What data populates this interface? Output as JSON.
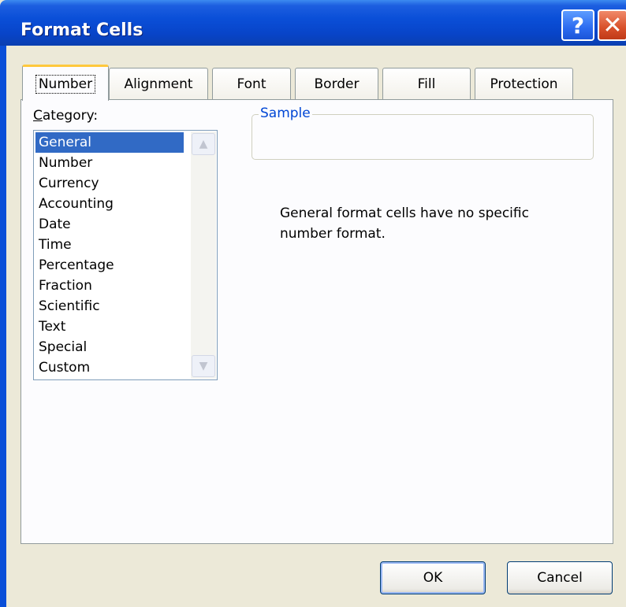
{
  "window": {
    "title": "Format Cells",
    "help_icon": "?",
    "close_icon": "✕"
  },
  "tabs": [
    {
      "label": "Number",
      "active": true
    },
    {
      "label": "Alignment"
    },
    {
      "label": "Font"
    },
    {
      "label": "Border"
    },
    {
      "label": "Fill"
    },
    {
      "label": "Protection"
    }
  ],
  "category": {
    "label": "Category:",
    "items": [
      "General",
      "Number",
      "Currency",
      "Accounting",
      "Date",
      "Time",
      "Percentage",
      "Fraction",
      "Scientific",
      "Text",
      "Special",
      "Custom"
    ],
    "selected": "General"
  },
  "sample": {
    "legend": "Sample",
    "value": ""
  },
  "description": "General format cells have no specific number format.",
  "buttons": {
    "ok": "OK",
    "cancel": "Cancel"
  },
  "colors": {
    "titlebar": "#0a4fd8",
    "selection": "#316ac5",
    "legend_text": "#0046d5"
  }
}
